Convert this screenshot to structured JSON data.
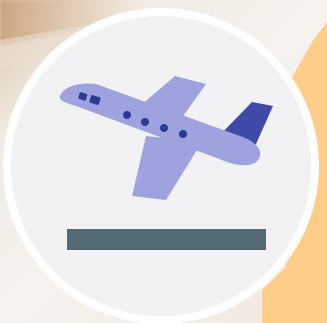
{
  "scene": {
    "subject": "airplane-takeoff-icon",
    "colors": {
      "background_light": "#f1ebe3",
      "background_warm": "#d8b58c",
      "circle_fill": "#f2f2f4",
      "circle_border": "#ffffff",
      "orange_shape": "#ffcd8a",
      "plane_body": "#9ea3df",
      "plane_tail": "#3f4aa8",
      "plane_windows": "#2d3a93",
      "runway": "#546a73"
    }
  }
}
